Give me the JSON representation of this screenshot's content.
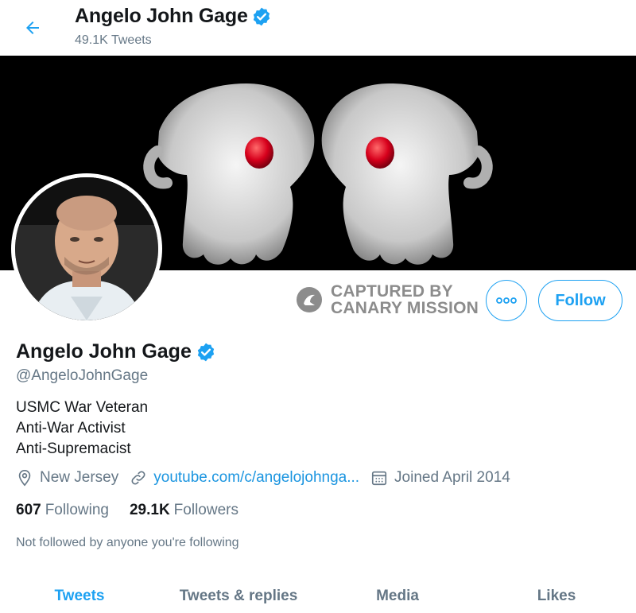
{
  "header": {
    "name": "Angelo John Gage",
    "tweet_count": "49.1K Tweets"
  },
  "watermark": {
    "line1": "CAPTURED BY",
    "line2": "CANARY MISSION"
  },
  "actions": {
    "follow_label": "Follow"
  },
  "profile": {
    "name": "Angelo John Gage",
    "handle": "@AngeloJohnGage",
    "bio": [
      "USMC War Veteran",
      "Anti-War Activist",
      "Anti-Supremacist"
    ],
    "location": "New Jersey",
    "website": "youtube.com/c/angelojohnga...",
    "joined": "Joined April 2014",
    "following_count": "607",
    "following_label": "Following",
    "followers_count": "29.1K",
    "followers_label": "Followers",
    "not_followed": "Not followed by anyone you're following"
  },
  "tabs": [
    {
      "label": "Tweets",
      "active": true
    },
    {
      "label": "Tweets & replies",
      "active": false
    },
    {
      "label": "Media",
      "active": false
    },
    {
      "label": "Likes",
      "active": false
    }
  ],
  "icons": {
    "back": "arrow-left-icon",
    "verified": "verified-badge-icon",
    "more": "more-dots-icon",
    "location": "location-pin-icon",
    "link": "link-icon",
    "calendar": "calendar-icon",
    "watermark_logo": "canary-logo-icon"
  },
  "colors": {
    "accent": "#1da1f2",
    "link": "#1b95e0",
    "muted": "#657786",
    "text": "#14171a",
    "banner_bg": "#000000",
    "pill": "#d7001c"
  }
}
